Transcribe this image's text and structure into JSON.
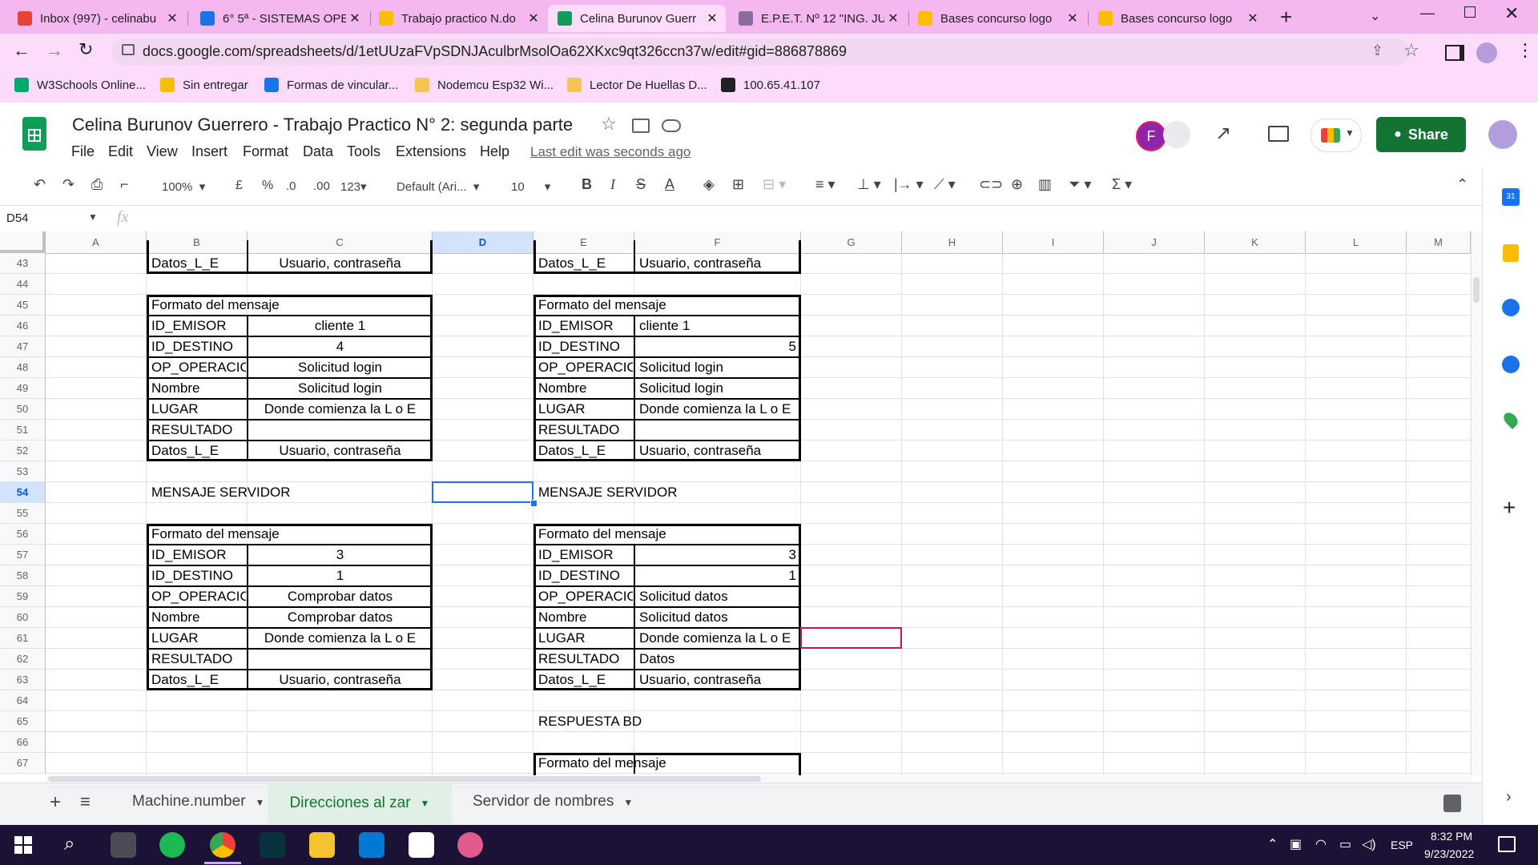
{
  "browser": {
    "tabs": [
      {
        "title": "Inbox (997) - celinabu",
        "fav": "#ea4335"
      },
      {
        "title": "6° 5ª - SISTEMAS OPE",
        "fav": "#1a73e8"
      },
      {
        "title": "Trabajo practico N.do",
        "fav": "#fbbc04"
      },
      {
        "title": "Celina Burunov Guerr",
        "fav": "#0f9d58"
      },
      {
        "title": "E.P.E.T. Nº 12 \"ING. JU",
        "fav": "#8a6d9c"
      },
      {
        "title": "Bases concurso logo",
        "fav": "#fbbc04"
      },
      {
        "title": "Bases concurso logo",
        "fav": "#fbbc04"
      }
    ],
    "new_tab": "+",
    "url": "docs.google.com/spreadsheets/d/1etUUzaFVpSDNJAculbrMsolOa62XKxc9qt326ccn37w/edit#gid=886878869",
    "bookmarks": [
      {
        "label": "W3Schools Online...",
        "color": "#04aa6d"
      },
      {
        "label": "Sin entregar",
        "color": "#fbbc04"
      },
      {
        "label": "Formas de vincular...",
        "color": "#1a73e8"
      },
      {
        "label": "Nodemcu Esp32 Wi...",
        "color": "#f6c453"
      },
      {
        "label": "Lector De Huellas D...",
        "color": "#f6c453"
      },
      {
        "label": "100.65.41.107",
        "color": "#202124"
      }
    ]
  },
  "doc": {
    "title": "Celina Burunov Guerrero - Trabajo Practico N° 2: segunda parte",
    "menus": [
      "File",
      "Edit",
      "View",
      "Insert",
      "Format",
      "Data",
      "Tools",
      "Extensions",
      "Help"
    ],
    "last_edit": "Last edit was seconds ago",
    "share": "Share",
    "avatar_letter": "F"
  },
  "toolbar": {
    "zoom": "100%",
    "currency": "£",
    "percent": "%",
    "dec_minus": ".0",
    "dec_plus": ".00",
    "format_123": "123",
    "font": "Default (Ari...",
    "size": "10"
  },
  "formula": {
    "namebox": "D54",
    "fx": "fx"
  },
  "columns": [
    "A",
    "B",
    "C",
    "D",
    "E",
    "F",
    "G",
    "H",
    "I",
    "J",
    "K",
    "L",
    "M"
  ],
  "rows": [
    "43",
    "44",
    "45",
    "46",
    "47",
    "48",
    "49",
    "50",
    "51",
    "52",
    "53",
    "54",
    "55",
    "56",
    "57",
    "58",
    "59",
    "60",
    "61",
    "62",
    "63",
    "64",
    "65",
    "66",
    "67"
  ],
  "cells": {
    "B43": "Datos_L_E",
    "C43": "Usuario, contraseña",
    "E43": "Datos_L_E",
    "F43": "Usuario, contraseña",
    "B45": "Formato del mensaje",
    "E45": "Formato del mensaje",
    "B46": "ID_EMISOR",
    "C46": "cliente 1",
    "E46": "ID_EMISOR",
    "F46": "cliente 1",
    "B47": "ID_DESTINO",
    "C47": "4",
    "E47": "ID_DESTINO",
    "F47": "5",
    "B48": "OP_OPERACIO",
    "C48": "Solicitud login",
    "E48": "OP_OPERACIO",
    "F48": "Solicitud login",
    "B49": "Nombre",
    "C49": "Solicitud login",
    "E49": "Nombre",
    "F49": "Solicitud login",
    "B50": "LUGAR",
    "C50": "Donde comienza la L o E",
    "E50": "LUGAR",
    "F50": "Donde comienza la L o E",
    "B51": "RESULTADO",
    "E51": "RESULTADO",
    "B52": "Datos_L_E",
    "C52": "Usuario, contraseña",
    "E52": "Datos_L_E",
    "F52": "Usuario, contraseña",
    "B54": "MENSAJE SERVIDOR",
    "E54": "MENSAJE SERVIDOR",
    "B56": "Formato del mensaje",
    "E56": "Formato del mensaje",
    "B57": "ID_EMISOR",
    "C57": "3",
    "E57": "ID_EMISOR",
    "F57": "3",
    "B58": "ID_DESTINO",
    "C58": "1",
    "E58": "ID_DESTINO",
    "F58": "1",
    "B59": "OP_OPERACIO",
    "C59": "Comprobar datos",
    "E59": "OP_OPERACIO",
    "F59": "Solicitud datos",
    "B60": "Nombre",
    "C60": "Comprobar datos",
    "E60": "Nombre",
    "F60": "Solicitud datos",
    "B61": "LUGAR",
    "C61": "Donde comienza la L o E",
    "E61": "LUGAR",
    "F61": "Donde comienza la L o E",
    "B62": "RESULTADO",
    "E62": "RESULTADO",
    "F62": "Datos",
    "B63": "Datos_L_E",
    "C63": "Usuario, contraseña",
    "E63": "Datos_L_E",
    "F63": "Usuario, contraseña",
    "E65": "RESPUESTA BD",
    "E67": "Formato del mensaje"
  },
  "sheet_tabs": [
    "Machine.number",
    "Direcciones al zar",
    "Servidor de nombres"
  ],
  "active_sheet": 1,
  "taskbar": {
    "lang": "ESP",
    "time": "8:32 PM",
    "date": "9/23/2022"
  }
}
